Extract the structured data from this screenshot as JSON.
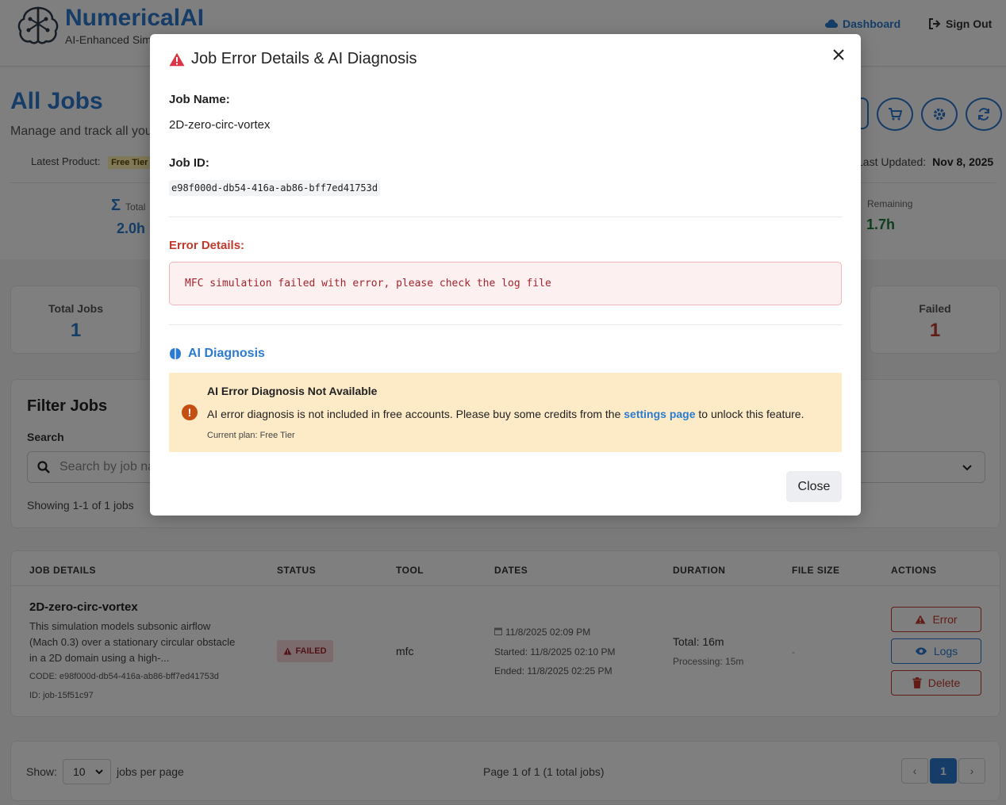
{
  "brand": {
    "name": "NumericalAI",
    "tagline": "AI-Enhanced Simulation"
  },
  "nav": {
    "dashboard": "Dashboard",
    "sign_out": "Sign Out"
  },
  "page": {
    "title": "All Jobs",
    "subtitle": "Manage and track all your simulation jobs",
    "latest_product_label": "Latest Product:",
    "plan_badge": "Free Tier",
    "last_updated_label": "Last Updated:",
    "last_updated_value": "Nov 8, 2025"
  },
  "stats": {
    "total_label": "Total",
    "total_value": "2.0h",
    "remaining_label": "Remaining",
    "remaining_value": "1.7h"
  },
  "summary": {
    "total_jobs_label": "Total Jobs",
    "total_jobs_value": "1",
    "failed_label": "Failed",
    "failed_value": "1"
  },
  "filter": {
    "title": "Filter Jobs",
    "search_label": "Search",
    "search_placeholder": "Search by job name",
    "showing": "Showing 1-1 of 1 jobs"
  },
  "table": {
    "headers": [
      "JOB DETAILS",
      "STATUS",
      "TOOL",
      "DATES",
      "DURATION",
      "FILE SIZE",
      "ACTIONS"
    ],
    "rows": [
      {
        "name": "2D-zero-circ-vortex",
        "description": "This simulation models subsonic airflow (Mach 0.3) over a stationary circular obstacle in a 2D domain using a high-...",
        "code": "CODE: e98f000d-db54-416a-ab86-bff7ed41753d",
        "id": "ID: job-15f51c97",
        "status": "FAILED",
        "tool": "mfc",
        "created": "11/8/2025 02:09 PM",
        "started": "Started: 11/8/2025 02:10 PM",
        "ended": "Ended: 11/8/2025 02:25 PM",
        "duration_total": "Total: 16m",
        "duration_processing": "Processing: 15m",
        "file_size": "-",
        "actions": [
          "Error",
          "Logs",
          "Delete"
        ]
      }
    ]
  },
  "pagination": {
    "show_label": "Show:",
    "per_page_value": "10",
    "per_page_label": "jobs per page",
    "info": "Page 1 of 1 (1 total jobs)",
    "current_page": "1",
    "prev": "‹",
    "next": "›"
  },
  "modal": {
    "title": "Job Error Details & AI Diagnosis",
    "job_name_label": "Job Name:",
    "job_name": "2D-zero-circ-vortex",
    "job_id_label": "Job ID:",
    "job_id": "e98f000d-db54-416a-ab86-bff7ed41753d",
    "error_label": "Error Details:",
    "error_text": "MFC simulation failed with error, please check the log file",
    "ai_title": "AI Diagnosis",
    "ai_head": "AI Error Diagnosis Not Available",
    "ai_msg_before": "AI error diagnosis is not included in free accounts. Please buy some credits from the ",
    "ai_msg_link": "settings page",
    "ai_msg_after": " to unlock this feature.",
    "ai_plan": "Current plan: Free Tier",
    "close": "Close"
  },
  "colors": {
    "accent": "#2b7bd0",
    "danger": "#c0392b",
    "warning_bg": "#fdebc8",
    "success": "#1e7a3c"
  }
}
